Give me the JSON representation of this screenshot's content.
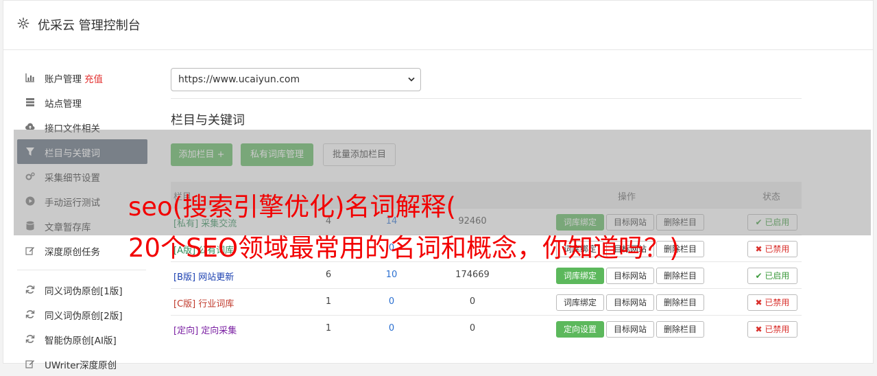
{
  "header": {
    "title": "优采云 管理控制台",
    "icon": "gear-icon"
  },
  "sidebar": {
    "items": [
      {
        "label": "账户管理",
        "badge": "充值",
        "icon": "bar-chart-icon"
      },
      {
        "label": "站点管理",
        "icon": "server-icon"
      },
      {
        "label": "接口文件相关",
        "icon": "cloud-upload-icon"
      },
      {
        "label": "栏目与关键词",
        "icon": "filter-icon",
        "active": true
      },
      {
        "label": "采集细节设置",
        "icon": "cogs-icon"
      },
      {
        "label": "手动运行测试",
        "icon": "play-circle-icon"
      },
      {
        "label": "文章暂存库",
        "icon": "database-icon"
      },
      {
        "label": "深度原创任务",
        "icon": "edit-icon"
      }
    ],
    "items2": [
      {
        "label": "同义词伪原创[1版]",
        "icon": "refresh-icon"
      },
      {
        "label": "同义词伪原创[2版]",
        "icon": "refresh-icon"
      },
      {
        "label": "智能伪原创[AI版]",
        "icon": "refresh-icon"
      },
      {
        "label": "UWriter深度原创",
        "icon": "edit-icon"
      }
    ]
  },
  "site_select": {
    "value": "https://www.ucaiyun.com"
  },
  "section": {
    "title": "栏目与关键词"
  },
  "toolbar": {
    "add_label": "添加栏目 +",
    "lib_label": "私有词库管理",
    "batch_label": "批量添加栏目"
  },
  "table": {
    "headers": {
      "name": "栏目",
      "op": "操作",
      "state": "状态"
    },
    "rows": [
      {
        "name": "[私有] 采集交流",
        "a": "4",
        "b": "14",
        "c": "92460",
        "btn1": "词库绑定",
        "btn2": "目标网站",
        "btn3": "删除栏目",
        "state": "已启用",
        "on": true
      },
      {
        "name": "[A版] 公有词库",
        "a": "",
        "b": "0",
        "c": "",
        "btn1": "词库绑定",
        "btn2": "目标网站",
        "btn3": "删除栏目",
        "state": "已禁用",
        "on": false
      },
      {
        "name": "[B版] 网站更新",
        "a": "6",
        "b": "10",
        "c": "174669",
        "btn1": "词库绑定",
        "btn2": "目标网站",
        "btn3": "删除栏目",
        "state": "已启用",
        "on": true
      },
      {
        "name": "[C版] 行业词库",
        "a": "1",
        "b": "0",
        "c": "0",
        "btn1": "词库绑定",
        "btn2": "目标网站",
        "btn3": "删除栏目",
        "state": "已禁用",
        "on": false
      },
      {
        "name": "[定向] 定向采集",
        "a": "1",
        "b": "0",
        "c": "0",
        "btn1": "定向设置",
        "btn2": "目标网站",
        "btn3": "删除栏目",
        "state": "已禁用",
        "on": false
      }
    ]
  },
  "banner": {
    "line1": "seo(搜索引擎优化)名词解释(",
    "line2": "20个SEO领域最常用的名词和概念，你知道吗？)"
  },
  "colors": {
    "accent": "#5cb85c",
    "active_nav": "#5c6a7a",
    "banner_text": "#f20000",
    "enabled": "#3c9a3c",
    "disabled": "#d9302c"
  }
}
